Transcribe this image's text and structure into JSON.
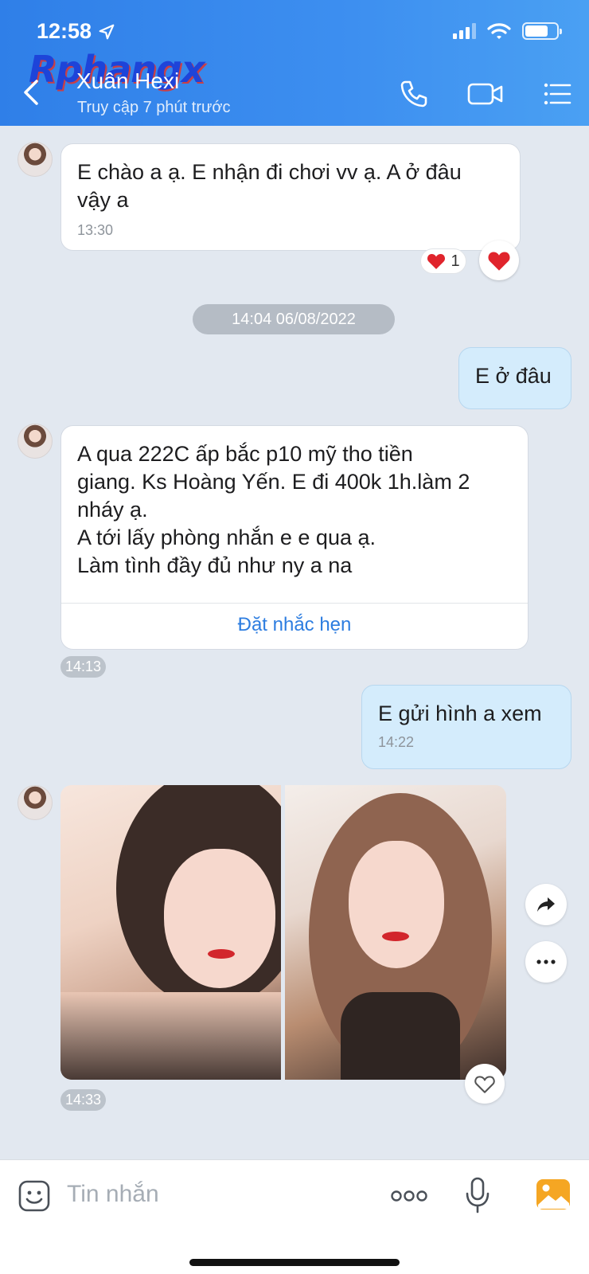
{
  "status_bar": {
    "time": "12:58"
  },
  "watermark": "Rphangx",
  "header": {
    "contact_name": "Xuân Hexi",
    "contact_status": "Truy cập 7 phút trước"
  },
  "messages": [
    {
      "direction": "in",
      "text_lines": [
        "E chào a ạ. E nhận đi chơi vv ạ. A ở đâu",
        "vậy a"
      ],
      "time": "13:30",
      "reaction": {
        "icon": "heart",
        "count": "1"
      }
    },
    {
      "type": "date_separator",
      "text": "14:04 06/08/2022"
    },
    {
      "direction": "out",
      "text": "E ở đâu"
    },
    {
      "direction": "in",
      "text_lines": [
        "A qua 222C ấp bắc p10 mỹ tho tiền",
        "giang. Ks Hoàng Yến. E đi 400k 1h.làm 2",
        "nháy ạ.",
        "A tới lấy phòng nhắn e e qua ạ.",
        "Làm tình đầy đủ như ny a na"
      ],
      "reminder_label": "Đặt nhắc hẹn",
      "time": "14:13"
    },
    {
      "direction": "out",
      "text": "E gửi hình a xem",
      "time": "14:22"
    },
    {
      "direction": "in",
      "type": "photos",
      "count": 2,
      "time": "14:33"
    }
  ],
  "input": {
    "placeholder": "Tin nhắn"
  },
  "colors": {
    "header": "#3d8ff0",
    "outgoing_bubble": "#d4ecfc",
    "accent": "#2d7de0",
    "heart": "#e0242c"
  }
}
